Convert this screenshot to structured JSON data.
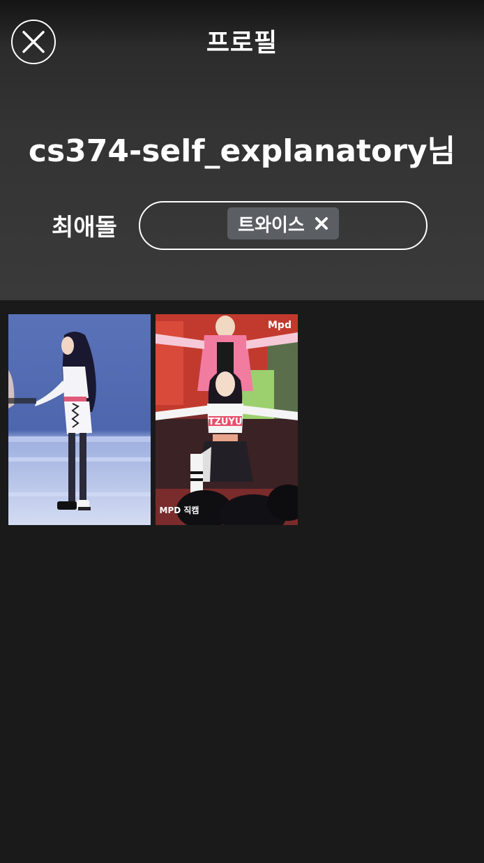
{
  "header": {
    "title": "프로필",
    "close_icon": "close-icon"
  },
  "profile": {
    "username": "cs374-self_explanatory님",
    "favorite_label": "최애돌",
    "favorite_tags": [
      {
        "label": "트와이스",
        "remove_icon": "x-icon"
      }
    ]
  },
  "gallery": {
    "items": [
      {
        "alt": "photo-1"
      },
      {
        "alt": "photo-2",
        "watermarks": [
          "Mpd",
          "MPD 직캠"
        ]
      }
    ]
  },
  "colors": {
    "background": "#1a1a1a",
    "header_bg": "#3a3a3a",
    "chip_bg": "#5b5e63",
    "text": "#ffffff"
  }
}
